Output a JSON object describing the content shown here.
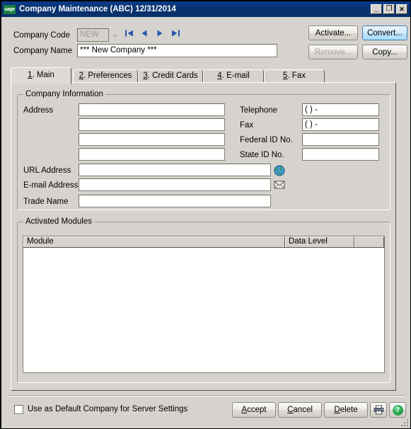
{
  "window": {
    "logo_text": "sage",
    "title": "Company Maintenance (ABC) 12/31/2014",
    "minimize_glyph": "_",
    "maximize_glyph": "❐",
    "close_glyph": "✕"
  },
  "header": {
    "company_code_label": "Company Code",
    "company_code_value": "NEW",
    "lookup_glyph": "⌐",
    "nav": [
      {
        "name": "first",
        "glyph": "◀◀"
      },
      {
        "name": "previous",
        "glyph": "◀"
      },
      {
        "name": "next",
        "glyph": "▶"
      },
      {
        "name": "last",
        "glyph": "▶▶"
      }
    ],
    "company_name_label": "Company Name",
    "company_name_value": "*** New Company ***",
    "buttons": {
      "activate": "Activate...",
      "convert": "Convert...",
      "remove": "Remove...",
      "copy": "Copy..."
    }
  },
  "tabs": [
    {
      "num": "1",
      "rest": ". Main"
    },
    {
      "num": "2",
      "rest": ". Preferences"
    },
    {
      "num": "3",
      "rest": ". Credit Cards"
    },
    {
      "num": "4",
      "rest": ". E-mail"
    },
    {
      "num": "5",
      "rest": ". Fax"
    }
  ],
  "company_information": {
    "title": "Company Information",
    "address_label": "Address",
    "address_lines": [
      "",
      "",
      "",
      ""
    ],
    "url_label": "URL Address",
    "url_value": "",
    "email_label": "E-mail Address",
    "email_value": "",
    "trade_name_label": "Trade Name",
    "trade_name_value": "",
    "telephone_label": "Telephone",
    "telephone_value": "(   )    -",
    "fax_label": "Fax",
    "fax_value": "(   )    -",
    "federal_id_label": "Federal ID No.",
    "federal_id_value": "",
    "state_id_label": "State ID No.",
    "state_id_value": "",
    "globe_icon": "globe-icon",
    "envelope_icon": "envelope-icon"
  },
  "activated_modules": {
    "title": "Activated Modules",
    "columns": [
      "Module",
      "Data Level",
      ""
    ],
    "rows": []
  },
  "footer": {
    "default_company_label": "Use as Default Company for Server Settings",
    "default_company_checked": false,
    "accept": {
      "accel": "A",
      "rest": "ccept"
    },
    "cancel": {
      "accel": "C",
      "rest": "ancel"
    },
    "delete": {
      "accel": "D",
      "rest": "elete"
    },
    "print_icon": "printer-icon",
    "help_icon": "help-icon",
    "help_glyph": "?"
  },
  "colors": {
    "titlebar": "#08306c",
    "dialog_face": "#d6d3ce",
    "accent_blue": "#2b56a8",
    "sage_green": "#1a8040",
    "highlight_button": "#bfe2fa"
  }
}
